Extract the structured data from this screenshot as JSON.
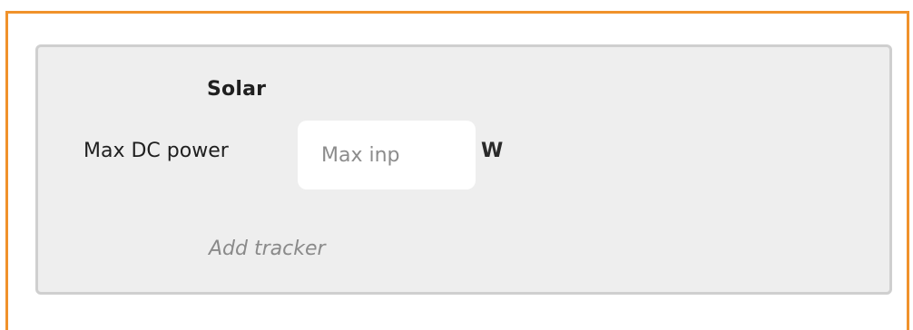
{
  "solar": {
    "title": "Solar",
    "max_dc_power": {
      "label": "Max DC power",
      "value": "",
      "placeholder": "Max inp",
      "unit": "W"
    },
    "add_tracker_label": "Add tracker"
  },
  "colors": {
    "frame_border": "#f0922b",
    "panel_background": "#eeeeee",
    "panel_border": "#cfcfcf",
    "link_text": "#8a8a8a"
  }
}
